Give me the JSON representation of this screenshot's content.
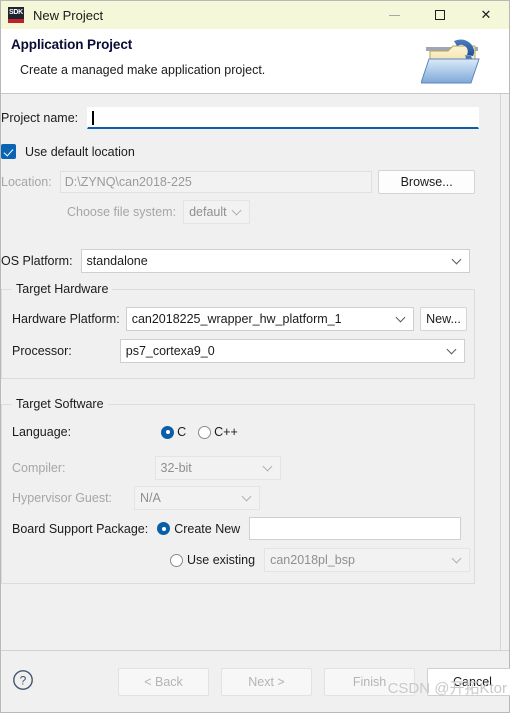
{
  "window": {
    "title": "New Project",
    "app_icon_label": "SDK",
    "minimize_label": "—",
    "maximize_label": "□",
    "close_label": "✕"
  },
  "header": {
    "title": "Application Project",
    "subtitle": "Create a managed make application project.",
    "graphic_name": "c-project-folder-icon"
  },
  "form": {
    "project_name": {
      "label": "Project name:",
      "value": "",
      "placeholder": ""
    },
    "use_default_location": {
      "label": "Use default location",
      "checked": true
    },
    "location": {
      "label": "Location:",
      "value": "D:\\ZYNQ\\can2018-225",
      "browse_label": "Browse...",
      "disabled": true
    },
    "file_system": {
      "label": "Choose file system:",
      "value": "default",
      "disabled": true
    },
    "os_platform": {
      "label": "OS Platform:",
      "value": "standalone"
    }
  },
  "target_hardware": {
    "group_title": "Target Hardware",
    "hardware_platform": {
      "label": "Hardware Platform:",
      "value": "can2018225_wrapper_hw_platform_1",
      "new_label": "New..."
    },
    "processor": {
      "label": "Processor:",
      "value": "ps7_cortexa9_0"
    }
  },
  "target_software": {
    "group_title": "Target Software",
    "language": {
      "label": "Language:",
      "options": [
        "C",
        "C++"
      ],
      "selected": "C"
    },
    "compiler": {
      "label": "Compiler:",
      "value": "32-bit",
      "disabled": true
    },
    "hypervisor_guest": {
      "label": "Hypervisor Guest:",
      "value": "N/A",
      "disabled": true
    },
    "board_support_package": {
      "label": "Board Support Package:",
      "create_new_label": "Create New",
      "create_new_value": "",
      "create_new_selected": true,
      "use_existing_label": "Use existing",
      "use_existing_value": "can2018pl_bsp",
      "use_existing_selected": false
    }
  },
  "footer": {
    "help_label": "?",
    "back_label": "< Back",
    "next_label": "Next >",
    "finish_label": "Finish",
    "cancel_label": "Cancel",
    "watermark": "CSDN @开拓Ktor"
  },
  "colors": {
    "titlebar_bg": "#f4f7d8",
    "accent_blue": "#0a5fa8",
    "body_bg": "#f0f0f0",
    "header_title": "#0b0b35"
  }
}
